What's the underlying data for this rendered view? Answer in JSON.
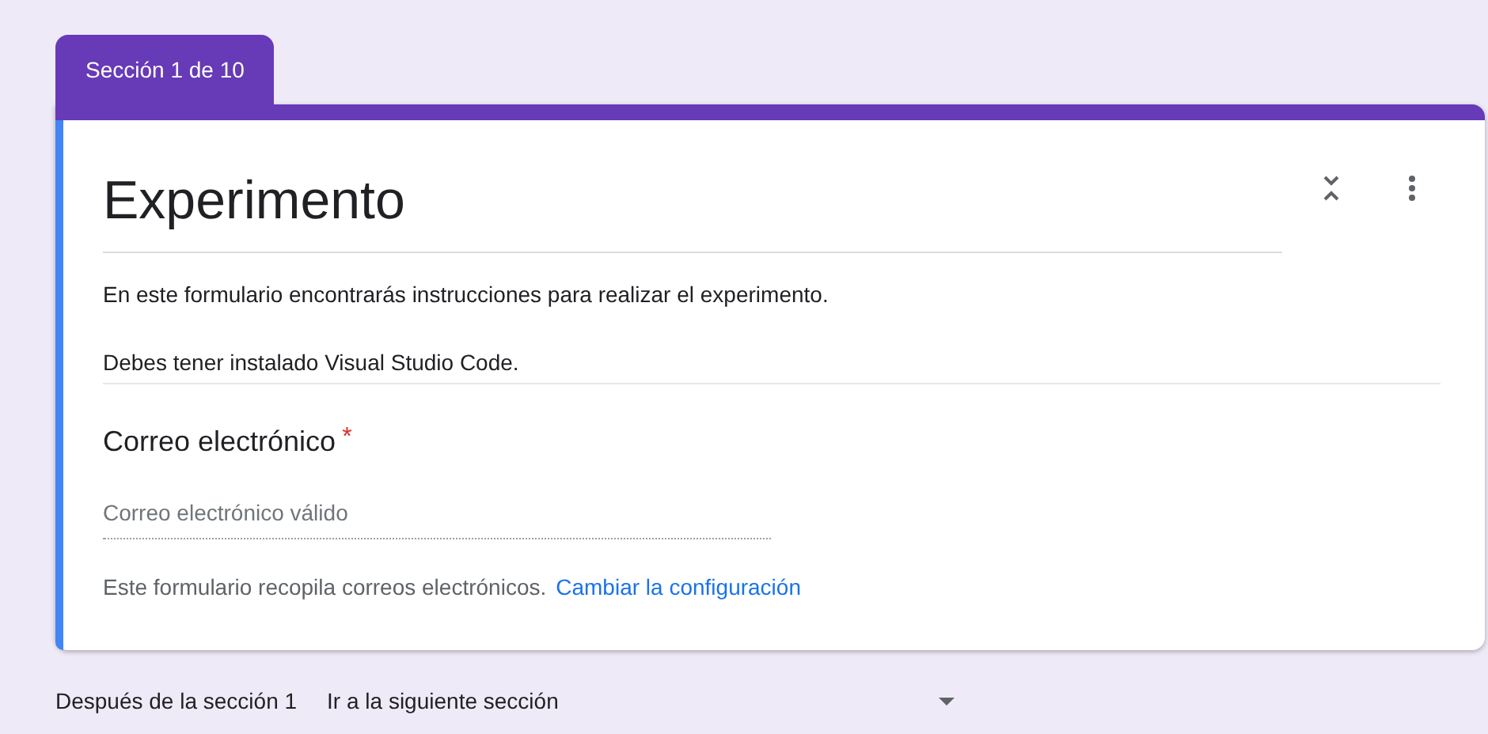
{
  "section_tab": "Sección 1 de 10",
  "section": {
    "title": "Experimento",
    "description": [
      "En este formulario encontrarás instrucciones para realizar el experimento.",
      "Debes tener instalado Visual Studio Code."
    ],
    "question": {
      "label": "Correo electrónico",
      "required_mark": "*",
      "placeholder": "Correo electrónico válido"
    },
    "note": "Este formulario recopila correos electrónicos.",
    "note_link": "Cambiar la configuración"
  },
  "after_section": {
    "label": "Después de la sección 1",
    "value": "Ir a la siguiente sección"
  }
}
